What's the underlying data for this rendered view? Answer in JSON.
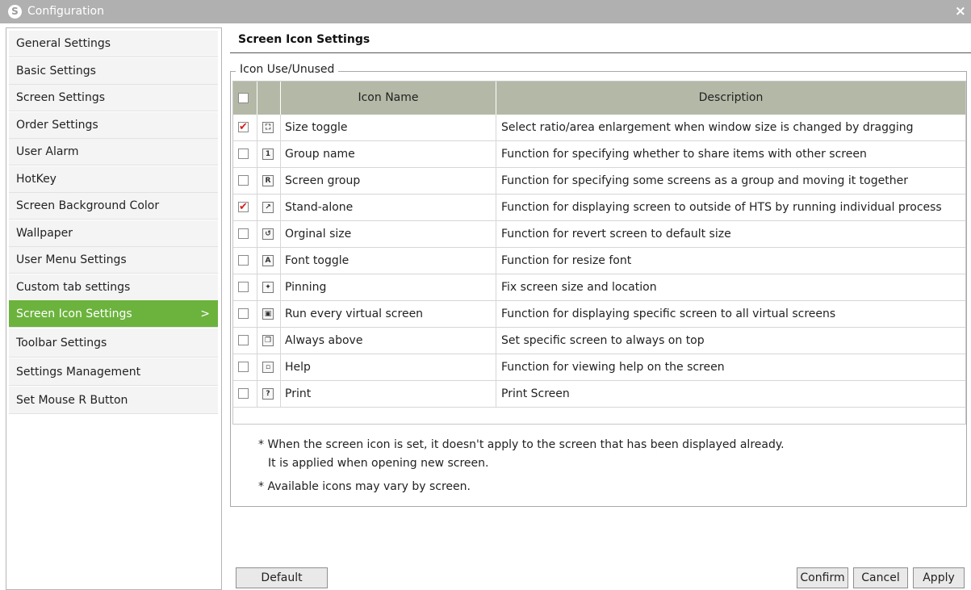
{
  "window": {
    "title": "Configuration"
  },
  "sidebar": {
    "items": [
      {
        "label": "General Settings",
        "active": false
      },
      {
        "label": "Basic Settings",
        "active": false
      },
      {
        "label": "Screen Settings",
        "active": false
      },
      {
        "label": "Order Settings",
        "active": false
      },
      {
        "label": "User Alarm",
        "active": false
      },
      {
        "label": "HotKey",
        "active": false
      },
      {
        "label": "Screen Background Color",
        "active": false
      },
      {
        "label": "Wallpaper",
        "active": false
      },
      {
        "label": "User Menu Settings",
        "active": false
      },
      {
        "label": "Custom tab settings",
        "active": false
      },
      {
        "label": "Screen Icon Settings",
        "active": true,
        "arrow": ">"
      },
      {
        "label": "Toolbar Settings",
        "active": false
      },
      {
        "label": "Settings Management",
        "active": false
      },
      {
        "label": "Set Mouse R Button",
        "active": false
      }
    ]
  },
  "panel": {
    "title": "Screen Icon Settings",
    "group_label": "Icon Use/Unused"
  },
  "table": {
    "headers": {
      "icon_name": "Icon Name",
      "description": "Description"
    },
    "rows": [
      {
        "checked": true,
        "icon": "resize-icon",
        "glyph": "⛶",
        "name": "Size toggle",
        "description": "Select ratio/area enlargement when window size is changed by dragging"
      },
      {
        "checked": false,
        "icon": "group-name-icon",
        "glyph": "1",
        "name": "Group name",
        "description": "Function for specifying whether to share items with other screen"
      },
      {
        "checked": false,
        "icon": "screen-group-icon",
        "glyph": "R",
        "name": "Screen group",
        "description": "Function for specifying some screens as a group and moving it together"
      },
      {
        "checked": true,
        "icon": "popout-icon",
        "glyph": "↗",
        "name": "Stand-alone",
        "description": "Function for displaying screen to outside of HTS by running individual process"
      },
      {
        "checked": false,
        "icon": "restore-size-icon",
        "glyph": "↺",
        "name": "Orginal size",
        "description": "Function for revert screen to default size"
      },
      {
        "checked": false,
        "icon": "font-icon",
        "glyph": "A",
        "name": "Font toggle",
        "description": "Function for resize font"
      },
      {
        "checked": false,
        "icon": "pin-icon",
        "glyph": "✦",
        "name": "Pinning",
        "description": "Fix screen size and location"
      },
      {
        "checked": false,
        "icon": "virtual-screen-icon",
        "glyph": "▣",
        "name": "Run every virtual screen",
        "description": "Function for displaying specific screen to all virtual screens"
      },
      {
        "checked": false,
        "icon": "always-on-top-icon",
        "glyph": "❐",
        "name": "Always above",
        "description": "Set specific screen to always on top"
      },
      {
        "checked": false,
        "icon": "help-icon",
        "glyph": "▫",
        "name": "Help",
        "description": "Function for viewing help on the screen"
      },
      {
        "checked": false,
        "icon": "print-icon",
        "glyph": "?",
        "name": "Print",
        "description": "Print Screen"
      }
    ]
  },
  "notes": {
    "line1": "*  When the screen icon is set, it doesn't apply to the screen that has been displayed already.",
    "line2": "It is applied when opening new screen.",
    "line3": "*  Available icons may vary by screen."
  },
  "buttons": {
    "default": "Default",
    "confirm": "Confirm",
    "cancel": "Cancel",
    "apply": "Apply"
  }
}
